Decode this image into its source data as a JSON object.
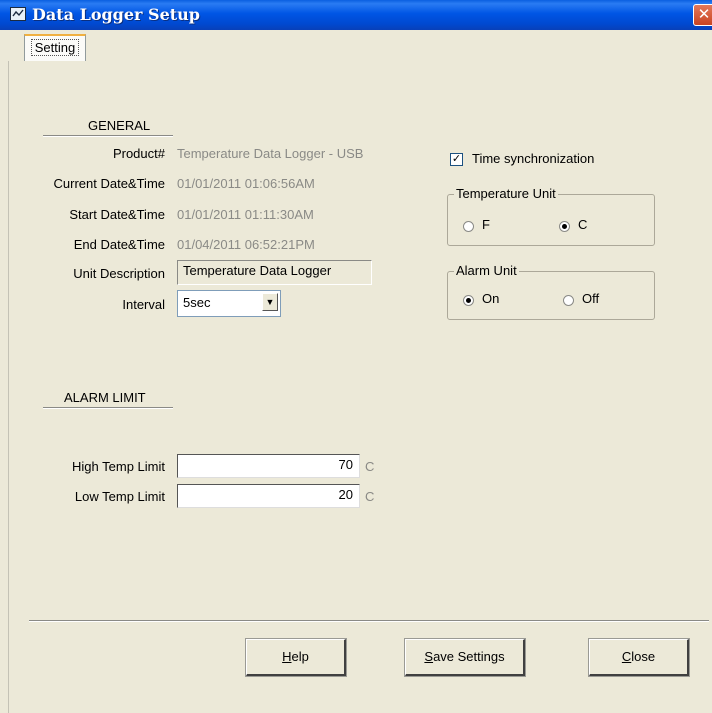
{
  "window": {
    "title": "Data Logger Setup",
    "close_glyph": "✕"
  },
  "tabs": [
    {
      "label": "Setting"
    }
  ],
  "general": {
    "heading": "GENERAL",
    "rows": [
      {
        "label": "Product#",
        "value": "Temperature Data Logger - USB"
      },
      {
        "label": "Current Date&Time",
        "value": "01/01/2011 01:06:56AM"
      },
      {
        "label": "Start Date&Time",
        "value": "01/01/2011 01:11:30AM"
      },
      {
        "label": "End Date&Time",
        "value": "01/04/2011 06:52:21PM"
      }
    ],
    "unit_description": {
      "label": "Unit Description",
      "value": "Temperature Data Logger"
    },
    "interval": {
      "label": "Interval",
      "value": "5sec"
    }
  },
  "time_sync": {
    "label": "Time synchronization",
    "checked": true,
    "check_glyph": "✓"
  },
  "temperature_unit": {
    "title": "Temperature Unit",
    "options": [
      {
        "label": "F",
        "checked": false
      },
      {
        "label": "C",
        "checked": true
      }
    ]
  },
  "alarm_unit": {
    "title": "Alarm Unit",
    "options": [
      {
        "label": "On",
        "checked": true
      },
      {
        "label": "Off",
        "checked": false
      }
    ]
  },
  "alarm_limit": {
    "heading": "ALARM LIMIT",
    "high": {
      "label": "High Temp Limit",
      "value": "70",
      "unit": "C"
    },
    "low": {
      "label": "Low Temp Limit",
      "value": "20",
      "unit": "C"
    }
  },
  "buttons": {
    "help": {
      "mnemonic": "H",
      "rest": "elp"
    },
    "save": {
      "mnemonic": "S",
      "rest": "ave Settings"
    },
    "close": {
      "mnemonic": "C",
      "rest": "lose"
    }
  },
  "colors": {
    "titlebar": "#0055e5",
    "dialog_bg": "#ece9d8",
    "close_button": "#c94422"
  }
}
